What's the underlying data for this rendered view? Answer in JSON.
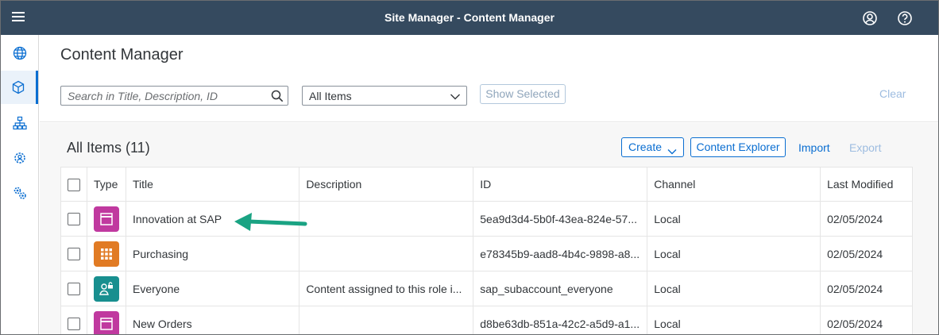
{
  "shellbar": {
    "title": "Site Manager - Content Manager"
  },
  "header": {
    "page_title": "Content Manager",
    "search_placeholder": "Search in Title, Description, ID",
    "filter_value": "All Items",
    "show_selected_label": "Show Selected",
    "clear_label": "Clear"
  },
  "list": {
    "title": "All Items (11)",
    "create_label": "Create",
    "content_explorer_label": "Content Explorer",
    "import_label": "Import",
    "export_label": "Export",
    "columns": [
      "Type",
      "Title",
      "Description",
      "ID",
      "Channel",
      "Last Modified"
    ],
    "rows": [
      {
        "type_icon": "page-icon",
        "type_color": "#c0399f",
        "title": "Innovation at SAP",
        "description": "",
        "id": "5ea9d3d4-5b0f-43ea-824e-57...",
        "channel": "Local",
        "last_modified": "02/05/2024"
      },
      {
        "type_icon": "apps-grid-icon",
        "type_color": "#e17b24",
        "title": "Purchasing",
        "description": "",
        "id": "e78345b9-aad8-4b4c-9898-a8...",
        "channel": "Local",
        "last_modified": "02/05/2024"
      },
      {
        "type_icon": "role-icon",
        "type_color": "#188f8f",
        "title": "Everyone",
        "description": "Content assigned to this role i...",
        "id": "sap_subaccount_everyone",
        "channel": "Local",
        "last_modified": "02/05/2024"
      },
      {
        "type_icon": "page-icon",
        "type_color": "#c0399f",
        "title": "New Orders",
        "description": "",
        "id": "d8be63db-851a-42c2-a5d9-a1...",
        "channel": "Local",
        "last_modified": "02/05/2024"
      }
    ]
  },
  "colors": {
    "shell": "#354a5f",
    "accent": "#0a6ed1",
    "arrow": "#1aa383"
  }
}
